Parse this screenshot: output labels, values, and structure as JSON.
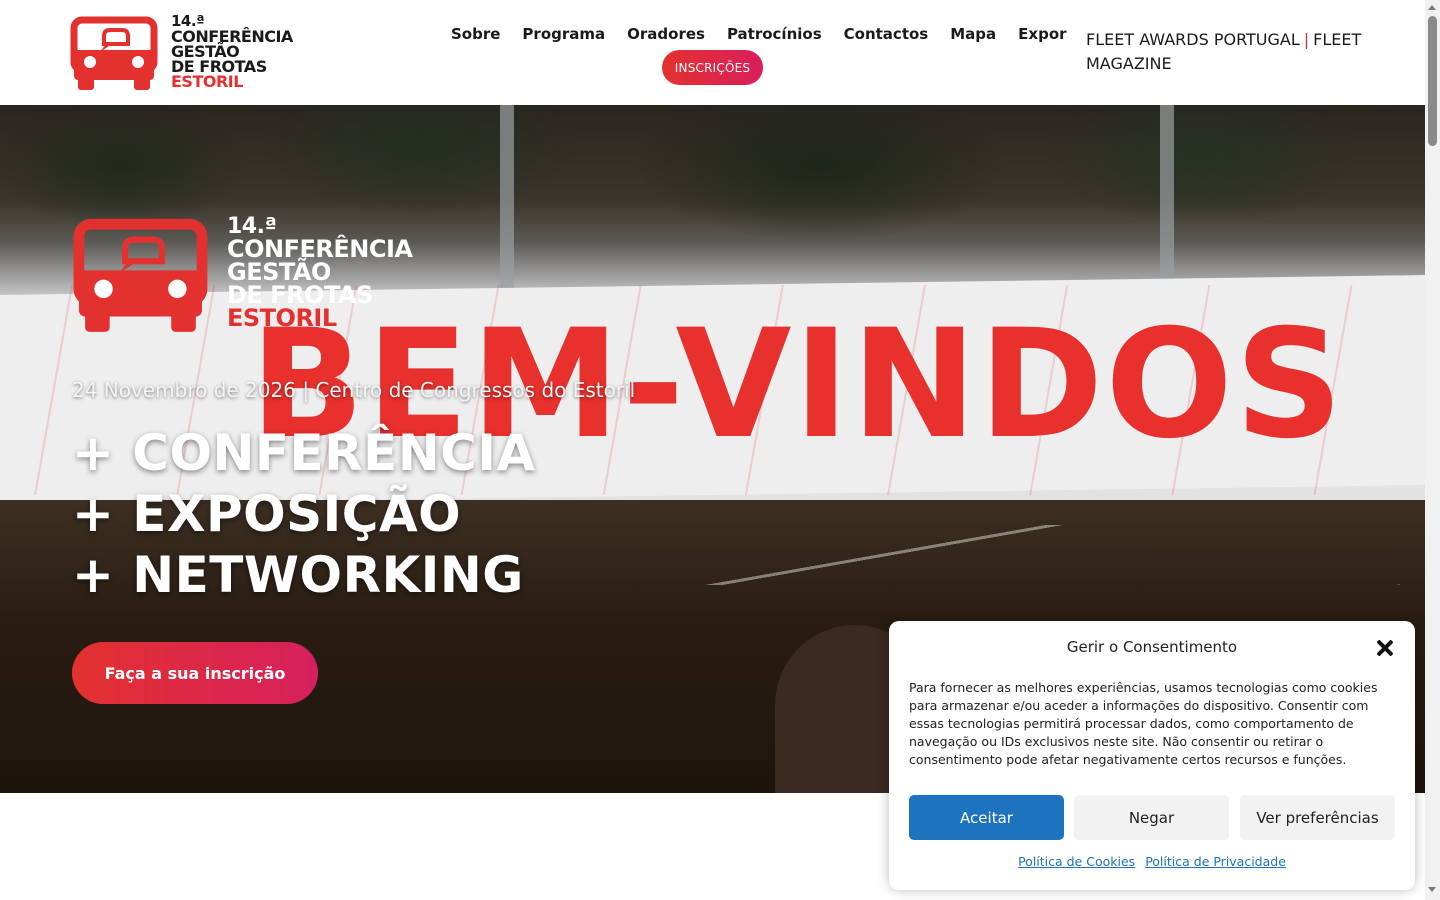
{
  "header": {
    "logo": {
      "line1": "14.ª",
      "line2": "CONFERÊNCIA",
      "line3": "GESTÃO",
      "line4": "DE FROTAS",
      "line5": "ESTORIL"
    },
    "nav": [
      "Sobre",
      "Programa",
      "Oradores",
      "Patrocínios",
      "Contactos",
      "Mapa",
      "Expor"
    ],
    "cta_label": "INSCRIÇÕES",
    "brand_links": {
      "first": "FLEET AWARDS PORTUGAL",
      "separator": "|",
      "second": "FLEET MAGAZINE"
    }
  },
  "hero": {
    "banner_text": "BEM-VINDOS",
    "date_location": "24 Novembro de 2026 | Centro de Congressos do Estoril",
    "slogans": [
      "+ CONFERÊNCIA",
      "+ EXPOSIÇÃO",
      "+ NETWORKING"
    ],
    "cta_label": "Faça a sua inscrição"
  },
  "consent": {
    "title": "Gerir o Consentimento",
    "body": "Para fornecer as melhores experiências, usamos tecnologias como cookies para armazenar e/ou aceder a informações do dispositivo. Consentir com essas tecnologias permitirá processar dados, como comportamento de navegação ou IDs exclusivos neste site. Não consentir ou retirar o consentimento pode afetar negativamente certos recursos e funções.",
    "accept": "Aceitar",
    "deny": "Negar",
    "preferences": "Ver preferências",
    "cookie_policy": "Política de Cookies",
    "privacy_policy": "Política de Privacidade"
  },
  "colors": {
    "brand_red": "#e3312f",
    "gradient_end": "#d6205e",
    "accept_blue": "#1e73be"
  },
  "icons": {
    "logo": "car-speech-bubble-logo",
    "close": "close-icon"
  }
}
